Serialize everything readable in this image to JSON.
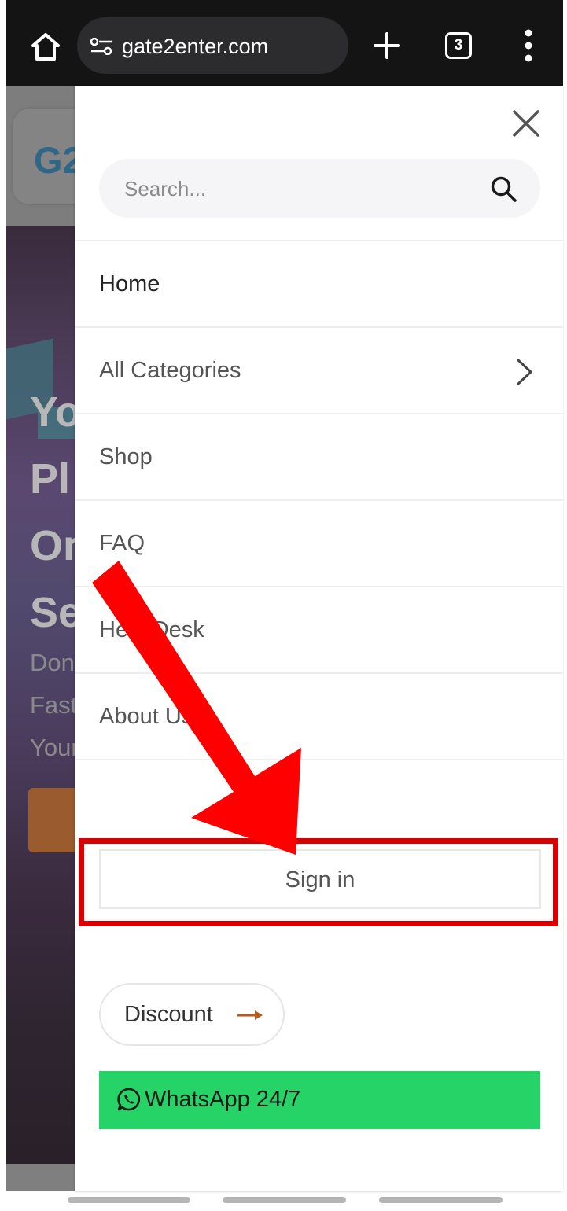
{
  "browser": {
    "url": "gate2enter.com",
    "tab_count": "3"
  },
  "background_page": {
    "logo_text": "G2",
    "hero_title_lines": [
      "Yo",
      "Pl",
      "Or",
      "Se"
    ],
    "hero_subtitle_lines": [
      "Don",
      "Fast",
      "Your"
    ]
  },
  "drawer": {
    "search": {
      "placeholder": "Search..."
    },
    "nav_items": [
      {
        "label": "Home",
        "active": true,
        "has_submenu": false
      },
      {
        "label": "All Categories",
        "active": false,
        "has_submenu": true
      },
      {
        "label": "Shop",
        "active": false,
        "has_submenu": false
      },
      {
        "label": "FAQ",
        "active": false,
        "has_submenu": false
      },
      {
        "label": "Help Desk",
        "active": false,
        "has_submenu": false
      },
      {
        "label": "About Us",
        "active": false,
        "has_submenu": false
      }
    ],
    "sign_in_label": "Sign in",
    "discount_label": "Discount",
    "whatsapp_label": "WhatsApp 24/7"
  },
  "colors": {
    "browser_bar": "#141414",
    "annotation_red": "#ff0000",
    "highlight_border": "#d70000",
    "whatsapp_green": "#25d366",
    "discount_arrow": "#b35a1f"
  },
  "icons": [
    "home-icon",
    "site-settings-icon",
    "plus-icon",
    "tab-switcher-icon",
    "more-vert-icon",
    "close-icon",
    "search-icon",
    "chevron-right-icon",
    "arrow-right-icon",
    "whatsapp-icon"
  ]
}
